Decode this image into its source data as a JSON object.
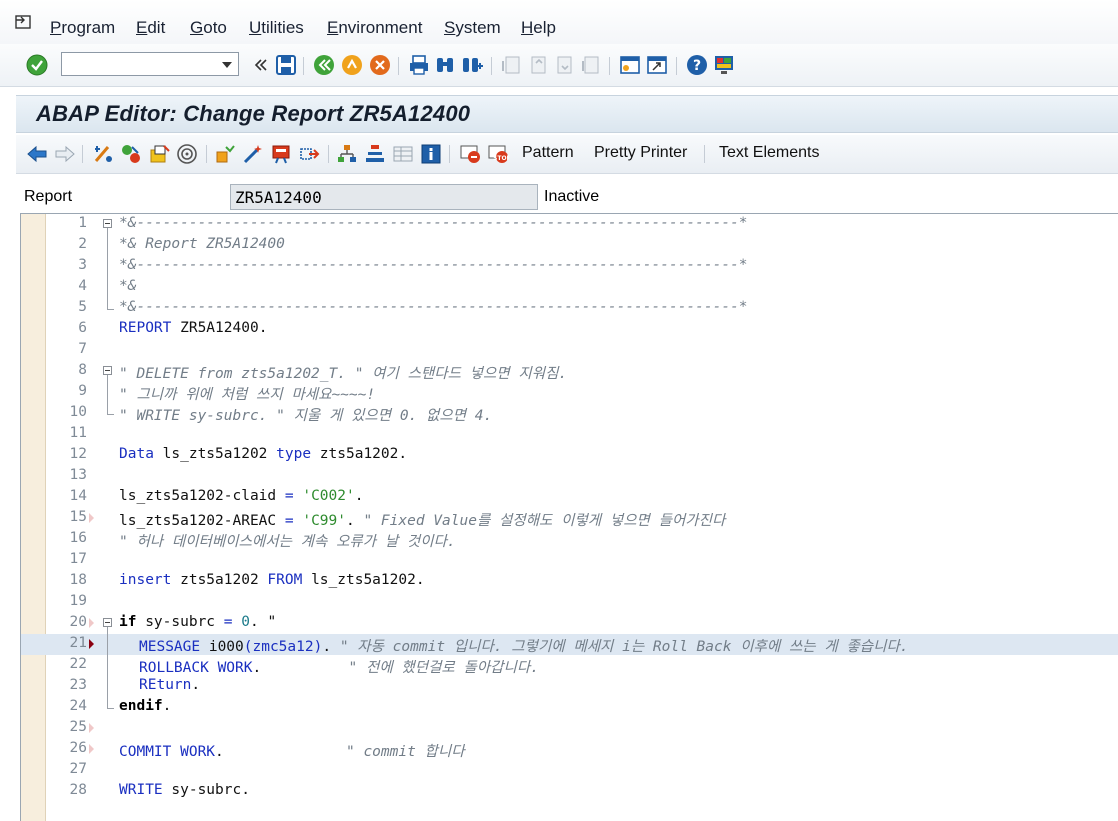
{
  "menu": {
    "items": [
      "Program",
      "Edit",
      "Goto",
      "Utilities",
      "Environment",
      "System",
      "Help"
    ]
  },
  "title": "ABAP Editor: Change Report ZR5A12400",
  "app_toolbar": {
    "pattern_label": "Pattern",
    "pretty_printer_label": "Pretty Printer",
    "text_elements_label": "Text Elements"
  },
  "report_row": {
    "label": "Report",
    "value": "ZR5A12400",
    "status": "Inactive"
  },
  "code_lines": [
    {
      "n": "1"
    },
    {
      "n": "2"
    },
    {
      "n": "3"
    },
    {
      "n": "4"
    },
    {
      "n": "5"
    },
    {
      "n": "6"
    },
    {
      "n": "7"
    },
    {
      "n": "8"
    },
    {
      "n": "9"
    },
    {
      "n": "10"
    },
    {
      "n": "11"
    },
    {
      "n": "12"
    },
    {
      "n": "13"
    },
    {
      "n": "14"
    },
    {
      "n": "15"
    },
    {
      "n": "16"
    },
    {
      "n": "17"
    },
    {
      "n": "18"
    },
    {
      "n": "19"
    },
    {
      "n": "20"
    },
    {
      "n": "21"
    },
    {
      "n": "22"
    },
    {
      "n": "23"
    },
    {
      "n": "24"
    },
    {
      "n": "25"
    },
    {
      "n": "26"
    },
    {
      "n": "27"
    },
    {
      "n": "28"
    }
  ],
  "code": {
    "l1": "*&---------------------------------------------------------------------*",
    "l2": "*& Report ZR5A12400",
    "l3": "*&---------------------------------------------------------------------*",
    "l4": "*&",
    "l5": "*&---------------------------------------------------------------------*",
    "l6_kw": "REPORT",
    "l6_rest": " ZR5A12400.",
    "l8": "\" DELETE from zts5a1202_T. \" 여기 스탠다드 넣으면 지워짐.",
    "l9": "\" 그니까 위에 처럼 쓰지 마세요~~~~!",
    "l10": "\" WRITE sy-subrc. \" 지울 게 있으면 0. 없으면 4.",
    "l12_kw1": "Data",
    "l12_a": " ls_zts5a1202 ",
    "l12_kw2": "type",
    "l12_b": " zts5a1202.",
    "l14_a": "ls_zts5a1202-claid ",
    "l14_eq": "=",
    "l14_str": "'C002'",
    "l14_end": ".",
    "l15_a": "ls_zts5a1202-AREAC ",
    "l15_eq": "=",
    "l15_str": "'C99'",
    "l15_end": ". ",
    "l15_cmt": "\" Fixed Value를 설정해도 이렇게 넣으면 들어가진다",
    "l16": "\" 허나 데이터베이스에서는 계속 오류가 날 것이다.",
    "l18_kw1": "insert",
    "l18_a": " zts5a1202 ",
    "l18_kw2": "FROM",
    "l18_b": " ls_zts5a1202.",
    "l20_kw": "if",
    "l20_a": " sy-subrc ",
    "l20_eq": "=",
    "l20_num": " 0",
    "l20_b": ". \"",
    "l21_kw": "MESSAGE",
    "l21_a": " i000",
    "l21_b": "(zmc5a12)",
    "l21_c": ". ",
    "l21_cmt": "\" 자동 commit 입니다. 그렇기에 메세지 i는 Roll Back 이후에 쓰는 게 좋습니다.",
    "l22_kw": "ROLLBACK WORK",
    "l22_a": ".          ",
    "l22_cmt": "\" 전에 했던걸로 돌아갑니다.",
    "l23_kw": "REturn",
    "l23_a": ".",
    "l24_kw": "endif",
    "l24_a": ".",
    "l26_kw": "COMMIT WORK",
    "l26_a": ".              ",
    "l26_cmt": "\" commit 합니다",
    "l28_kw": "WRITE",
    "l28_a": " sy-subrc."
  },
  "colors": {
    "keyword": "#1a2fc0",
    "string": "#2e8b2e",
    "comment": "#727d88",
    "highlight_line": "#dde7f2"
  }
}
